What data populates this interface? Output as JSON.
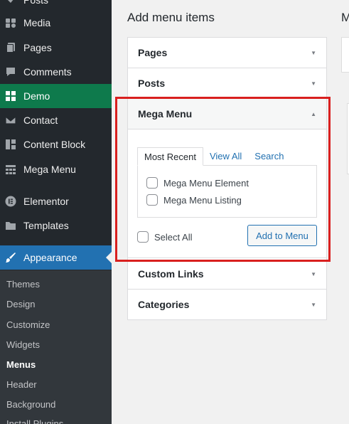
{
  "sidebar": {
    "items": [
      {
        "label": "Posts",
        "icon": "pin-icon"
      },
      {
        "label": "Media",
        "icon": "media-icon"
      },
      {
        "label": "Pages",
        "icon": "pages-icon"
      },
      {
        "label": "Comments",
        "icon": "comments-icon"
      },
      {
        "label": "Demo",
        "icon": "grid-icon"
      },
      {
        "label": "Contact",
        "icon": "mail-icon"
      },
      {
        "label": "Content Block",
        "icon": "layout-icon"
      },
      {
        "label": "Mega Menu",
        "icon": "mega-menu-icon"
      },
      {
        "label": "Elementor",
        "icon": "elementor-icon"
      },
      {
        "label": "Templates",
        "icon": "folder-icon"
      },
      {
        "label": "Appearance",
        "icon": "brush-icon"
      }
    ],
    "submenu": [
      "Themes",
      "Design",
      "Customize",
      "Widgets",
      "Menus",
      "Header",
      "Background",
      "Install Plugins"
    ],
    "current_submenu": "Menus"
  },
  "main": {
    "title": "Add menu items",
    "right_title": "M"
  },
  "accordion": {
    "sections": [
      "Pages",
      "Posts",
      "Mega Menu",
      "Custom Links",
      "Categories"
    ],
    "open_section": "Mega Menu",
    "tabs": [
      "Most Recent",
      "View All",
      "Search"
    ],
    "items": [
      "Mega Menu Element",
      "Mega Menu Listing"
    ],
    "select_all_label": "Select All",
    "add_button_label": "Add to Menu",
    "collapsed_arrow": "▼",
    "open_arrow": "▲"
  },
  "colors": {
    "sidebar_bg": "#23282d",
    "demo_active": "#0e7a4c",
    "appearance_active": "#2271b1",
    "highlight": "#d9201f"
  }
}
